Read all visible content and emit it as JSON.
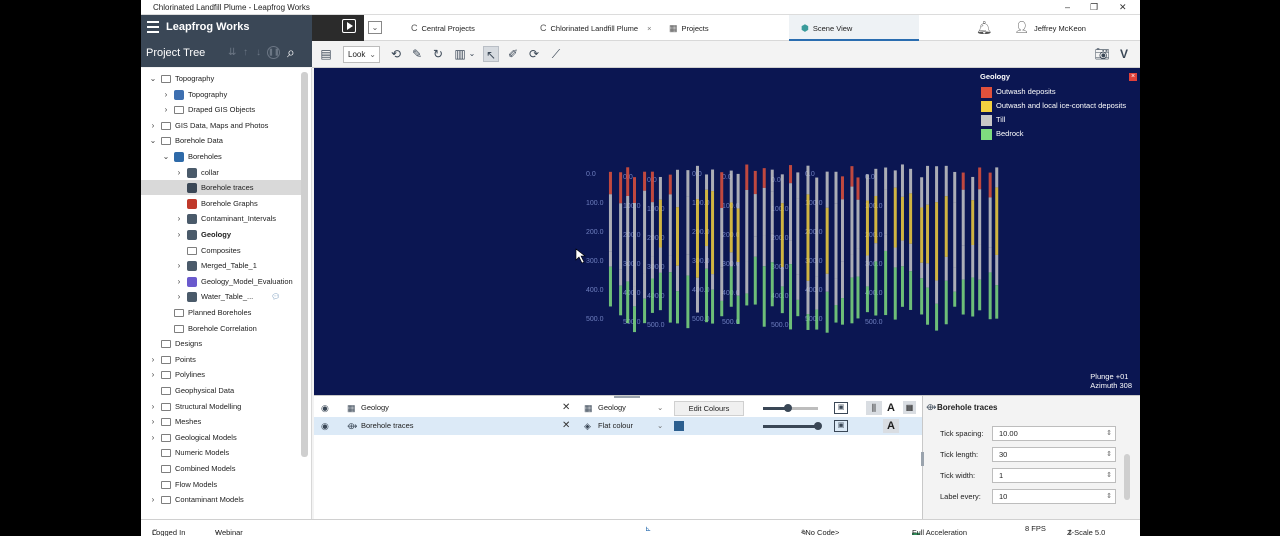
{
  "window": {
    "title": "Chlorinated Landfill Plume - Leapfrog Works"
  },
  "header": {
    "brand": "Leapfrog Works",
    "tabs": [
      {
        "label": "Central Projects",
        "icon": "central-projects-icon"
      },
      {
        "label": "Chlorinated Landfill Plume",
        "icon": "project-icon"
      },
      {
        "label": "Projects",
        "icon": "projects-icon"
      },
      {
        "label": "Scene View",
        "icon": "scene-view-icon",
        "active": true
      }
    ],
    "user": "Jeffrey McKeon"
  },
  "tree": {
    "title": "Project Tree",
    "items": [
      {
        "label": "Topography",
        "level": 0,
        "expander": "open"
      },
      {
        "label": "Topography",
        "level": 1,
        "expander": "closed",
        "icon": "topography-icon"
      },
      {
        "label": "Draped GIS Objects",
        "level": 1,
        "expander": "closed",
        "icon": "folder-icon"
      },
      {
        "label": "GIS Data, Maps and Photos",
        "level": 0,
        "expander": "closed"
      },
      {
        "label": "Borehole Data",
        "level": 0,
        "expander": "open"
      },
      {
        "label": "Boreholes",
        "level": 1,
        "expander": "open",
        "icon": "boreholes-icon"
      },
      {
        "label": "collar",
        "level": 2,
        "expander": "closed",
        "icon": "table-icon"
      },
      {
        "label": "Borehole traces",
        "level": 2,
        "expander": "none",
        "icon": "borehole-traces-icon",
        "selected": true
      },
      {
        "label": "Borehole Graphs",
        "level": 2,
        "expander": "none",
        "icon": "graph-icon"
      },
      {
        "label": "Contaminant_Intervals",
        "level": 2,
        "expander": "closed",
        "icon": "table-icon"
      },
      {
        "label": "Geology",
        "level": 2,
        "expander": "closed",
        "icon": "table-icon",
        "bold": true
      },
      {
        "label": "Composites",
        "level": 2,
        "expander": "none",
        "icon": "folder-icon"
      },
      {
        "label": "Merged_Table_1",
        "level": 2,
        "expander": "closed",
        "icon": "merged-table-icon"
      },
      {
        "label": "Geology_Model_Evaluation",
        "level": 2,
        "expander": "closed",
        "icon": "evaluation-icon"
      },
      {
        "label": "Water_Table_...",
        "level": 2,
        "expander": "closed",
        "icon": "table-icon",
        "comment": true
      },
      {
        "label": "Planned Boreholes",
        "level": 1,
        "expander": "none",
        "icon": "folder-icon"
      },
      {
        "label": "Borehole Correlation",
        "level": 1,
        "expander": "none",
        "icon": "folder-icon"
      },
      {
        "label": "Designs",
        "level": 0,
        "expander": "none"
      },
      {
        "label": "Points",
        "level": 0,
        "expander": "closed"
      },
      {
        "label": "Polylines",
        "level": 0,
        "expander": "closed"
      },
      {
        "label": "Geophysical Data",
        "level": 0,
        "expander": "none"
      },
      {
        "label": "Structural Modelling",
        "level": 0,
        "expander": "closed"
      },
      {
        "label": "Meshes",
        "level": 0,
        "expander": "closed"
      },
      {
        "label": "Geological Models",
        "level": 0,
        "expander": "closed"
      },
      {
        "label": "Numeric Models",
        "level": 0,
        "expander": "none"
      },
      {
        "label": "Combined Models",
        "level": 0,
        "expander": "none"
      },
      {
        "label": "Flow Models",
        "level": 0,
        "expander": "none"
      },
      {
        "label": "Contaminant Models",
        "level": 0,
        "expander": "closed"
      }
    ]
  },
  "toolbar": {
    "look_label": "Look"
  },
  "scene": {
    "legend": {
      "title": "Geology",
      "items": [
        {
          "label": "Outwash deposits",
          "color": "#e0513c"
        },
        {
          "label": "Outwash and local ice-contact deposits",
          "color": "#f2d040"
        },
        {
          "label": "Till",
          "color": "#c8c8c8"
        },
        {
          "label": "Bedrock",
          "color": "#7fdc7f"
        }
      ]
    },
    "plunge": "Plunge +01",
    "azimuth": "Azimuth 308",
    "depth_labels": [
      "0.0",
      "100.0",
      "200.0",
      "300.0",
      "400.0",
      "500.0"
    ]
  },
  "shapes": [
    {
      "name": "Geology",
      "colouring": "Geology",
      "edit_label": "Edit Colours",
      "opacity": 0.45
    },
    {
      "name": "Borehole traces",
      "colouring": "Flat colour",
      "swatch": "#2c5f8f",
      "opacity": 1.0,
      "selected": true
    }
  ],
  "properties": {
    "title": "Borehole traces",
    "fields": [
      {
        "label": "Tick spacing:",
        "value": "10.00"
      },
      {
        "label": "Tick length:",
        "value": "30"
      },
      {
        "label": "Tick width:",
        "value": "1"
      },
      {
        "label": "Label every:",
        "value": "10"
      }
    ]
  },
  "status": {
    "login": "Logged In",
    "branch": "Webinar",
    "code": "<No Code>",
    "acceleration": "Full Acceleration",
    "fps": "8 FPS",
    "zscale": "Z-Scale 5.0"
  }
}
